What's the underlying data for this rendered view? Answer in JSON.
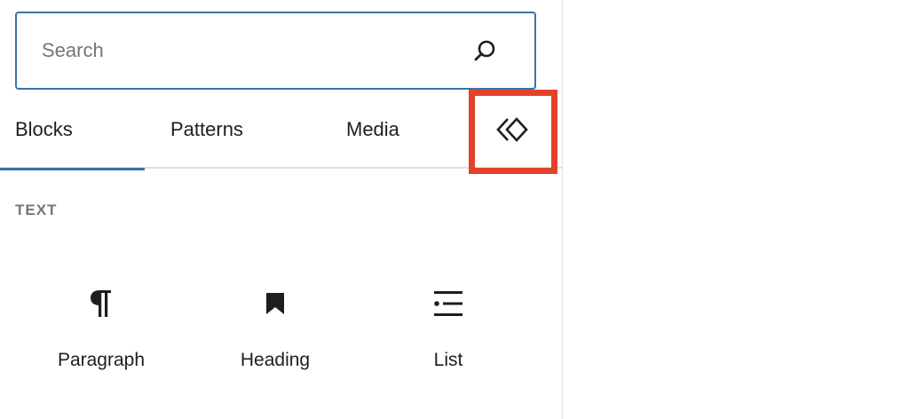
{
  "search": {
    "placeholder": "Search",
    "value": ""
  },
  "tabs": [
    {
      "label": "Blocks",
      "active": true
    },
    {
      "label": "Patterns",
      "active": false
    },
    {
      "label": "Media",
      "active": false
    },
    {
      "icon": "reusable-blocks-icon",
      "highlighted": true
    }
  ],
  "section": {
    "title": "TEXT"
  },
  "blocks": [
    {
      "label": "Paragraph",
      "icon": "paragraph-icon"
    },
    {
      "label": "Heading",
      "icon": "heading-bookmark-icon"
    },
    {
      "label": "List",
      "icon": "list-icon"
    }
  ],
  "colors": {
    "accent": "#3a73a8",
    "highlight": "#e4412b",
    "muted_text": "#757575",
    "text": "#1e1e1e"
  }
}
